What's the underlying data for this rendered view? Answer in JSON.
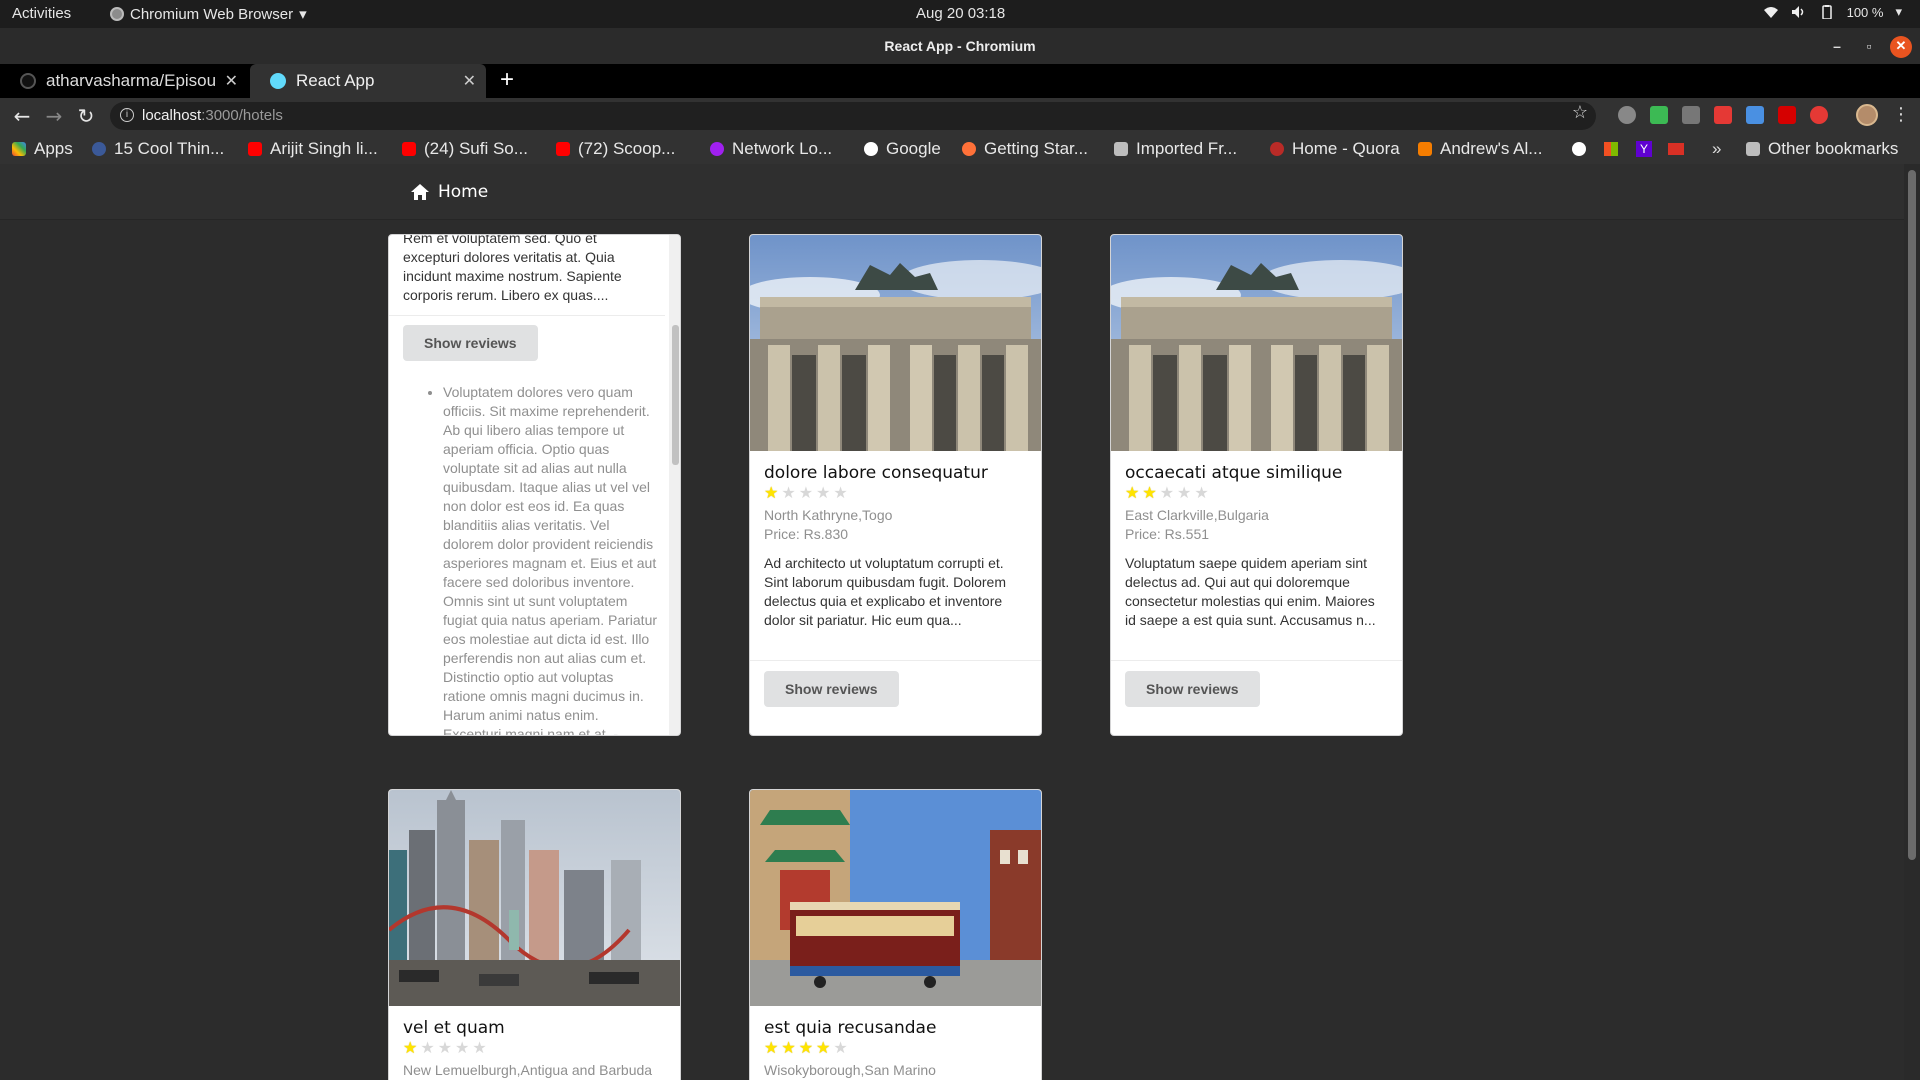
{
  "system": {
    "activities": "Activities",
    "app_name": "Chromium Web Browser",
    "clock": "Aug 20  03:18",
    "battery": "100 %"
  },
  "window": {
    "title": "React App - Chromium"
  },
  "tabs": [
    {
      "label": "atharvasharma/Episou",
      "active": false
    },
    {
      "label": "React App",
      "active": true
    }
  ],
  "address": {
    "host": "localhost",
    "path": ":3000/hotels"
  },
  "bookmarks": [
    {
      "label": "Apps",
      "color": "#4285f4"
    },
    {
      "label": "15 Cool Thin...",
      "color": "#3b5998"
    },
    {
      "label": "Arijit Singh li...",
      "color": "#ff0000"
    },
    {
      "label": "(24) Sufi So...",
      "color": "#ff0000"
    },
    {
      "label": "(72) Scoop...",
      "color": "#ff0000"
    },
    {
      "label": "Network Lo...",
      "color": "#a020f0"
    },
    {
      "label": "Google",
      "color": "#ffffff"
    },
    {
      "label": "Getting Star...",
      "color": "#ff7139"
    },
    {
      "label": "Imported Fr...",
      "color": "#bdbdbd"
    },
    {
      "label": "Home - Quora",
      "color": "#b92b27"
    },
    {
      "label": "Andrew's Al...",
      "color": "#f57d00"
    },
    {
      "label": "Other bookmarks",
      "color": "#bdbdbd"
    }
  ],
  "nav": {
    "home": "Home"
  },
  "first_card": {
    "top_text": "Rem et voluptatem sed. Quo et excepturi dolores veritatis at. Quia incidunt maxime nostrum. Sapiente corporis rerum. Libero ex quas....",
    "button": "Show reviews",
    "review": "Voluptatem dolores vero quam officiis. Sit maxime reprehenderit. Ab qui libero alias tempore ut aperiam officia. Optio quas voluptate sit ad alias aut nulla quibusdam. Itaque alias ut vel vel non dolor est eos id. Ea quas blanditiis alias veritatis. Vel dolorem dolor provident reiciendis asperiores magnam et. Eius et aut facere sed doloribus inventore. Omnis sint ut sunt voluptatem fugiat quia natus aperiam. Pariatur eos molestiae aut dicta id est. Illo perferendis non aut alias cum et. Distinctio optio aut voluptas ratione omnis magni ducimus in. Harum animi natus enim. Excepturi magni nam et at. -"
  },
  "hotels": [
    {
      "name": "dolore labore consequatur",
      "rating": 1,
      "location": "North Kathryne,Togo",
      "price": "Price: Rs.830",
      "description": "Ad architecto ut voluptatum corrupti et. Sint laborum quibusdam fugit. Dolorem delectus quia et explicabo et inventore dolor sit pariatur. Hic eum qua...",
      "button": "Show reviews",
      "image": "brandenburg-gate"
    },
    {
      "name": "occaecati atque similique",
      "rating": 2,
      "location": "East Clarkville,Bulgaria",
      "price": "Price: Rs.551",
      "description": "Voluptatum saepe quidem aperiam sint delectus ad. Qui aut qui doloremque consectetur molestias qui enim. Maiores id saepe a est quia sunt. Accusamus n...",
      "button": "Show reviews",
      "image": "brandenburg-gate"
    },
    {
      "name": "vel et quam",
      "rating": 1,
      "location": "New Lemuelburgh,Antigua and Barbuda",
      "image": "las-vegas-skyline"
    },
    {
      "name": "est quia recusandae",
      "rating": 4,
      "location": "Wisokyborough,San Marino",
      "image": "cable-car-chinatown"
    }
  ]
}
